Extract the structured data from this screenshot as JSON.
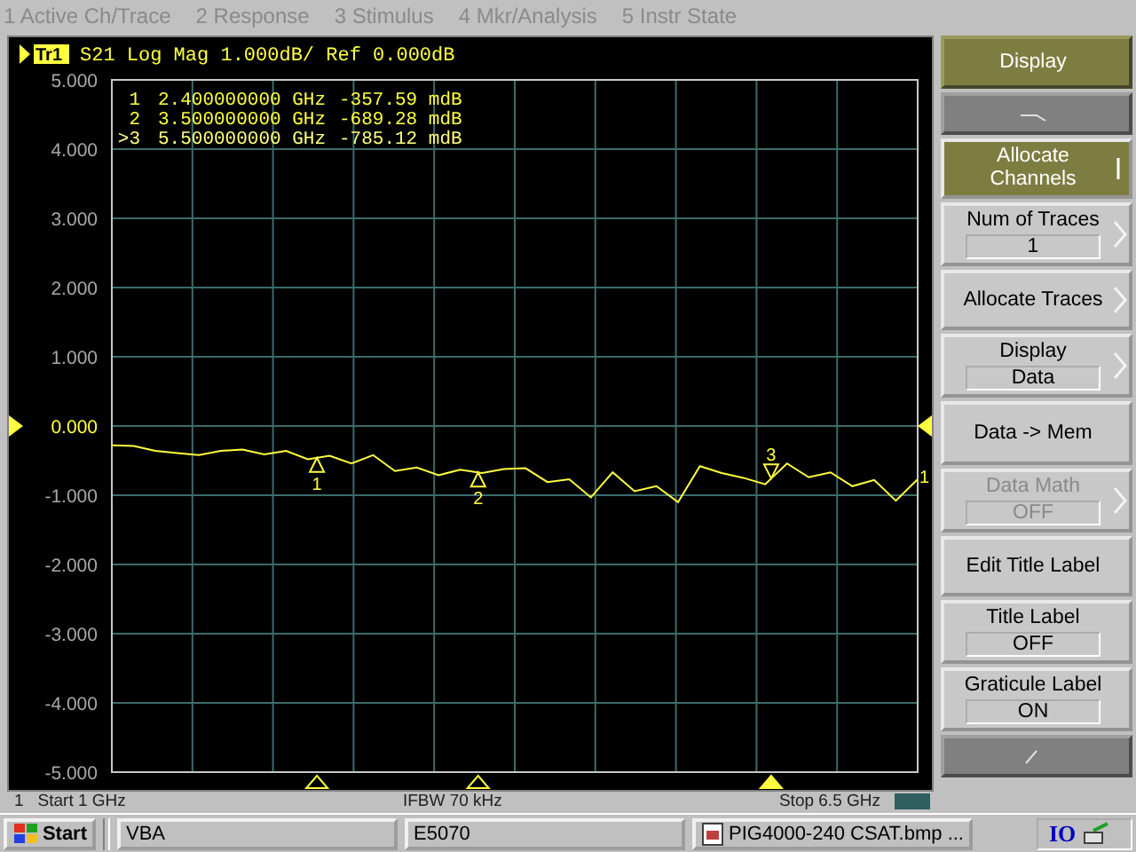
{
  "menu_bar": {
    "items": [
      "1 Active Ch/Trace",
      "2 Response",
      "3 Stimulus",
      "4 Mkr/Analysis",
      "5 Instr State"
    ]
  },
  "plot": {
    "header": "S21 Log Mag 1.000dB/ Ref 0.000dB",
    "trace_end_label": "1",
    "markers": [
      {
        "label": "1",
        "active": false
      },
      {
        "label": "2",
        "active": false
      },
      {
        "label": "3",
        "active": true
      }
    ],
    "marker_readout": [
      {
        "label": "1",
        "stimulus": "2.400000000 GHz",
        "response": "-357.59 mdB",
        "active": false
      },
      {
        "label": "2",
        "stimulus": "3.500000000 GHz",
        "response": "-689.28 mdB",
        "active": false
      },
      {
        "label": ">3",
        "stimulus": "5.500000000 GHz",
        "response": "-785.12 mdB",
        "active": true
      }
    ],
    "chart_data": {
      "type": "line",
      "grid": true,
      "ylim": [
        -5,
        5
      ],
      "yticks": [
        {
          "value": 5,
          "label": "5.000"
        },
        {
          "value": 4,
          "label": "4.000"
        },
        {
          "value": 3,
          "label": "3.000"
        },
        {
          "value": 2,
          "label": "2.000"
        },
        {
          "value": 1,
          "label": "1.000"
        },
        {
          "value": 0,
          "label": "0.000"
        },
        {
          "value": -1,
          "label": "-1.000"
        },
        {
          "value": -2,
          "label": "-2.000"
        },
        {
          "value": -3,
          "label": "-3.000"
        },
        {
          "value": -4,
          "label": "-4.000"
        },
        {
          "value": -5,
          "label": "-5.000"
        }
      ],
      "categories": [
        null,
        null,
        null,
        null,
        null,
        null,
        null,
        null,
        null,
        null,
        null,
        null,
        null,
        null,
        null,
        null,
        null,
        null,
        null,
        null,
        null,
        null,
        null,
        null,
        null,
        null,
        null,
        null,
        null,
        null,
        null,
        null,
        null,
        null,
        null,
        null,
        null,
        null
      ],
      "series": [
        {
          "name": "Tr1",
          "color": "#ffff40",
          "values": [
            -0.28,
            -0.29,
            -0.36,
            -0.39,
            -0.42,
            -0.36,
            -0.34,
            -0.41,
            -0.36,
            -0.48,
            -0.43,
            -0.54,
            -0.42,
            -0.65,
            -0.6,
            -0.71,
            -0.63,
            -0.68,
            -0.62,
            -0.61,
            -0.81,
            -0.77,
            -1.03,
            -0.67,
            -0.94,
            -0.87,
            -1.1,
            -0.58,
            -0.68,
            -0.75,
            -0.84,
            -0.54,
            -0.74,
            -0.67,
            -0.87,
            -0.78,
            -1.08,
            -0.77
          ]
        }
      ]
    }
  },
  "status_bar": {
    "channel": "1",
    "start": "Start 1 GHz",
    "ifbw": "IFBW 70 kHz",
    "stop": "Stop 6.5 GHz"
  },
  "softkeys": [
    {
      "kind": "header",
      "label": "Display"
    },
    {
      "kind": "nav_up"
    },
    {
      "kind": "menu",
      "label": "Allocate Channels",
      "selected": true,
      "disabled": false,
      "submenu": true
    },
    {
      "kind": "value",
      "label": "Num of Traces",
      "value": "1",
      "selected": false,
      "disabled": false,
      "submenu": true
    },
    {
      "kind": "menu",
      "label": "Allocate Traces",
      "selected": false,
      "disabled": false,
      "submenu": true
    },
    {
      "kind": "value",
      "label": "Display",
      "value": "Data",
      "selected": false,
      "disabled": false,
      "submenu": true
    },
    {
      "kind": "menu",
      "label": "Data -> Mem",
      "selected": false,
      "disabled": false,
      "submenu": false
    },
    {
      "kind": "value",
      "label": "Data Math",
      "value": "OFF",
      "selected": false,
      "disabled": true,
      "submenu": true
    },
    {
      "kind": "menu",
      "label": "Edit Title Label",
      "selected": false,
      "disabled": false,
      "submenu": false
    },
    {
      "kind": "value",
      "label": "Title Label",
      "value": "OFF",
      "selected": false,
      "disabled": false,
      "submenu": false
    },
    {
      "kind": "value",
      "label": "Graticule Label",
      "value": "ON",
      "selected": false,
      "disabled": false,
      "submenu": false
    },
    {
      "kind": "nav_down"
    }
  ],
  "taskbar": {
    "start": "Start",
    "tasks": [
      {
        "label": "VBA",
        "kind": "plain"
      },
      {
        "label": "E5070",
        "kind": "plain"
      },
      {
        "label": "PIG4000-240  CSAT.bmp ...",
        "kind": "file"
      }
    ],
    "tray": "IO"
  }
}
